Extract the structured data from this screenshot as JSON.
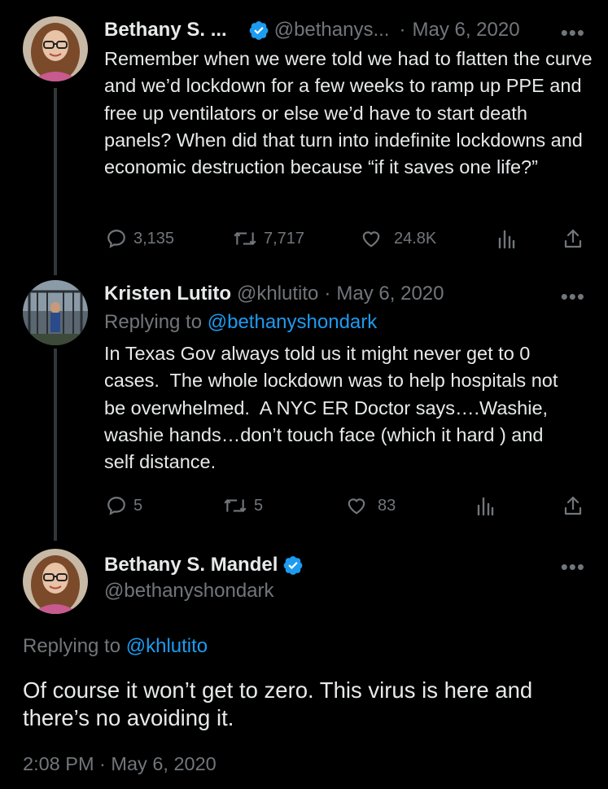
{
  "colors": {
    "background": "#000000",
    "text": "#e7e9ea",
    "muted": "#71767b",
    "link": "#1d9bf0",
    "verified": "#1d9bf0",
    "thread_line": "#333639"
  },
  "tweet1": {
    "name": "Bethany S. ...",
    "verified": true,
    "handle": "@bethanys...",
    "separator": "·",
    "date": "May 6, 2020",
    "more": "•••",
    "text": "Remember when we were told we had to flatten the curve and we’d lockdown for a few weeks to ramp up PPE and free up ventilators or else we’d have to start death panels? When did that turn into indefinite lockdowns and economic destruction because “if it saves one life?”",
    "replies": "3,135",
    "retweets": "7,717",
    "likes": "24.8K",
    "icons": [
      "reply-icon",
      "retweet-icon",
      "like-icon",
      "views-icon",
      "share-icon"
    ]
  },
  "tweet2": {
    "name": "Kristen Lutito",
    "handle": "@khlutito",
    "separator": "·",
    "date": "May 6, 2020",
    "more": "•••",
    "replying_prefix": "Replying to",
    "replying_to": "@bethanyshondark",
    "text": "In Texas Gov always told us it might never get to 0 cases.  The whole lockdown was to help hospitals not be overwhelmed.  A NYC ER Doctor says….Washie, washie hands…don’t touch face (which it hard ) and self distance.",
    "replies": "5",
    "retweets": "5",
    "likes": "83"
  },
  "tweet3": {
    "name": "Bethany S. Mandel",
    "verified": true,
    "handle": "@bethanyshondark",
    "more": "•••",
    "replying_prefix": "Replying to",
    "replying_to": "@khlutito",
    "text": "Of course it won’t get to zero. This virus is here and there’s no avoiding it.",
    "timestamp": "2:08 PM · May 6, 2020"
  }
}
